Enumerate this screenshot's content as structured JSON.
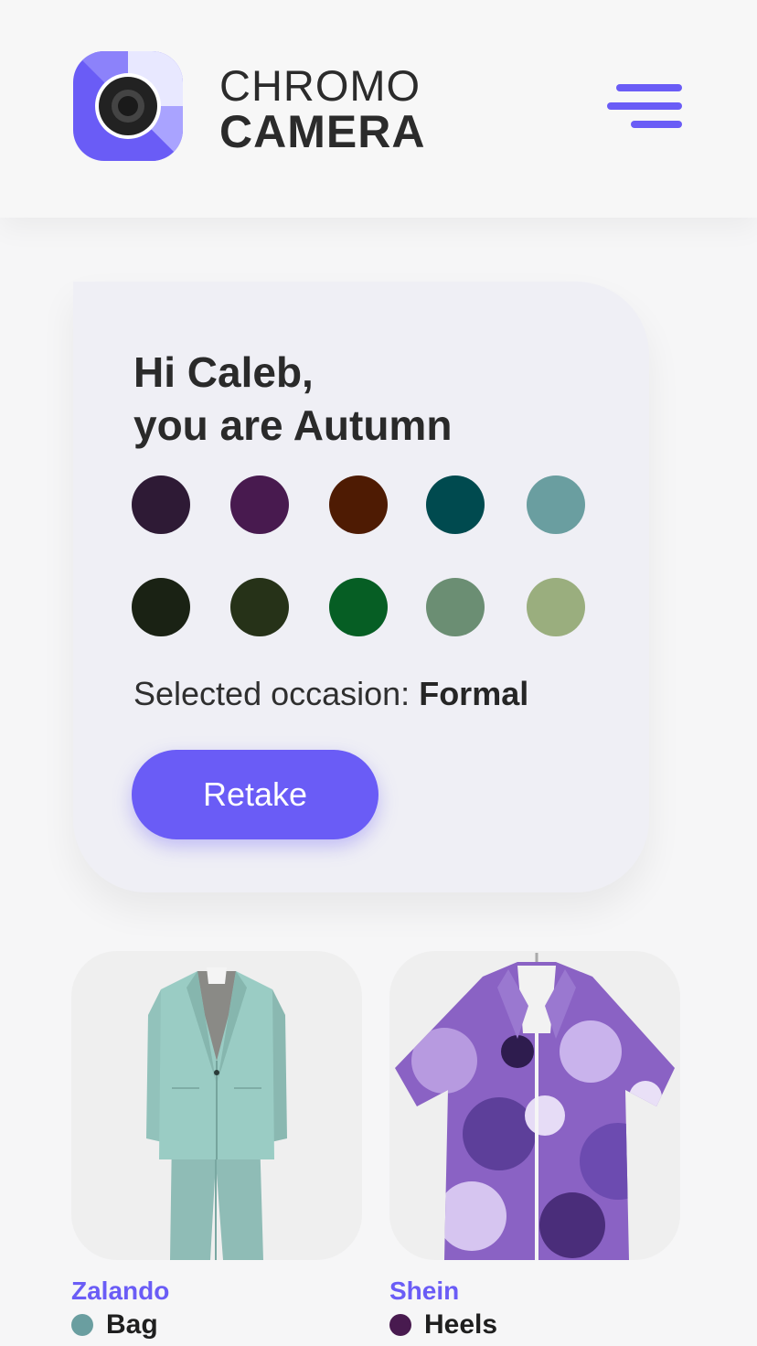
{
  "header": {
    "brand_line1": "CHROMO",
    "brand_line2": "CAMERA"
  },
  "profile": {
    "greeting_line1": "Hi Caleb,",
    "greeting_line2": "you are Autumn",
    "palette": [
      "#2e1a35",
      "#481a4f",
      "#4e1b03",
      "#004a4f",
      "#6a9ea0",
      "#1a2214",
      "#263218",
      "#065e24",
      "#6b8e73",
      "#9aae7e"
    ],
    "occasion_label": "Selected occasion:",
    "occasion_value": "Formal",
    "retake_label": "Retake"
  },
  "products": [
    {
      "store": "Zalando",
      "item": "Bag",
      "dot_color": "#6a9ea0"
    },
    {
      "store": "Shein",
      "item": "Heels",
      "dot_color": "#481a4f"
    }
  ]
}
